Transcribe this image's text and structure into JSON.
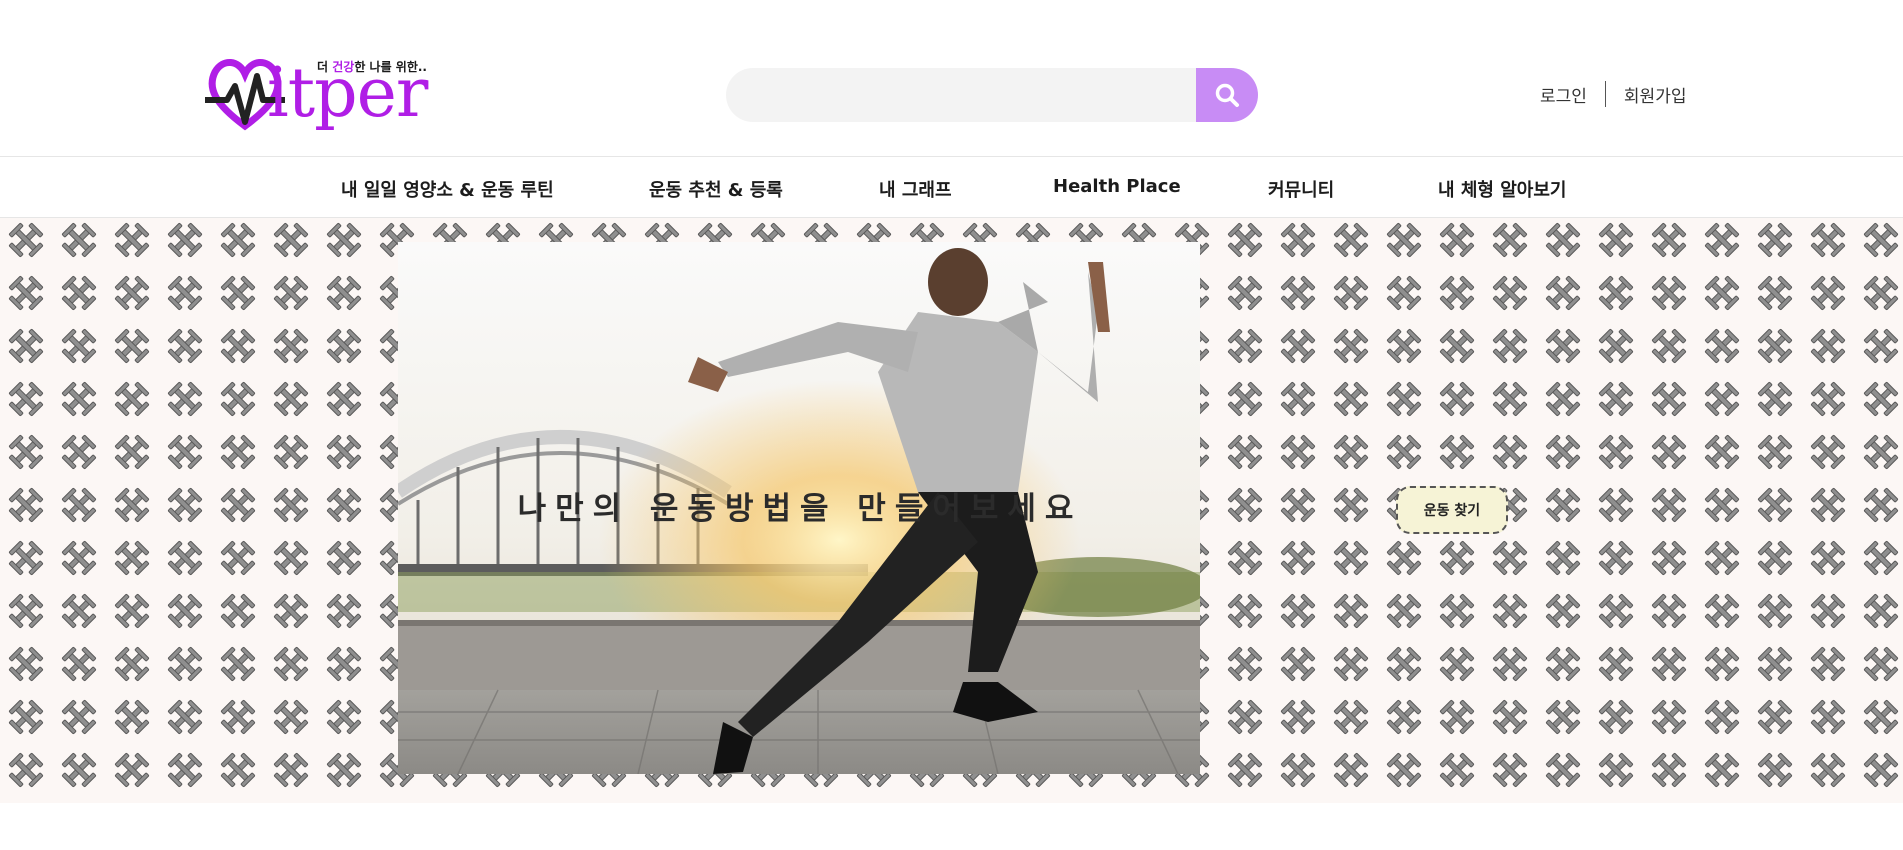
{
  "brand": {
    "name": "itper",
    "tagline_pre": "더 ",
    "tagline_accent": "건강",
    "tagline_post": "한 나를 위한..",
    "accent_color": "#b01ee6"
  },
  "search": {
    "placeholder": "",
    "value": "",
    "button_icon": "search-icon",
    "button_color": "#c88cf5"
  },
  "auth": {
    "login": "로그인",
    "signup": "회원가입"
  },
  "nav": {
    "items": [
      {
        "label": "내 일일 영양소 & 운동 루틴"
      },
      {
        "label": "운동 추천 & 등록"
      },
      {
        "label": "내 그래프"
      },
      {
        "label": "Health Place"
      },
      {
        "label": "커뮤니티"
      },
      {
        "label": "내 체형 알아보기"
      }
    ]
  },
  "hero": {
    "headline": "나만의 운동방법을 만들어보세요",
    "cta": "운동 찾기",
    "pattern_icon": "dumbbell-icon",
    "photo_subject": "runner-sprinting-photo"
  }
}
